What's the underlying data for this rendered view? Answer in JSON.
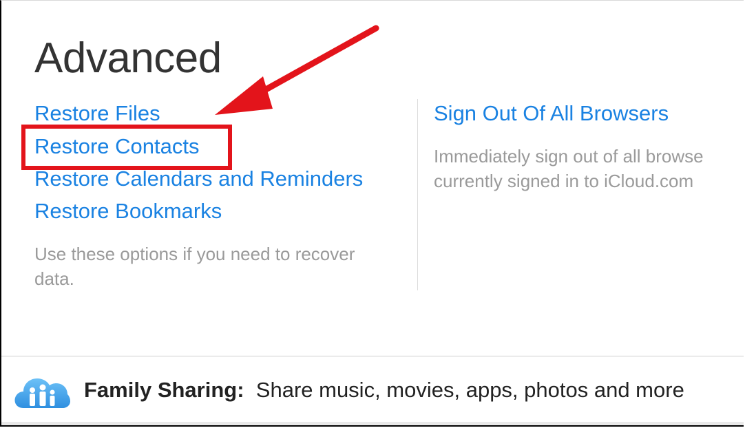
{
  "section": {
    "title": "Advanced",
    "links": [
      {
        "label": "Restore Files"
      },
      {
        "label": "Restore Contacts"
      },
      {
        "label": "Restore Calendars and Reminders"
      },
      {
        "label": "Restore Bookmarks"
      }
    ],
    "description": "Use these options if you need to recover data."
  },
  "sign_out": {
    "label": "Sign Out Of All Browsers",
    "description_line1": "Immediately sign out of all browse",
    "description_line2": "currently signed in to iCloud.com"
  },
  "family_sharing": {
    "label": "Family Sharing:",
    "text": "Share music, movies, apps, photos and more",
    "icon": "family-cloud-icon"
  },
  "annotation": {
    "color": "#e3141b",
    "arrow_icon": "arrow-icon"
  },
  "colors": {
    "link": "#1a82e2",
    "muted": "#9a9a9a"
  }
}
